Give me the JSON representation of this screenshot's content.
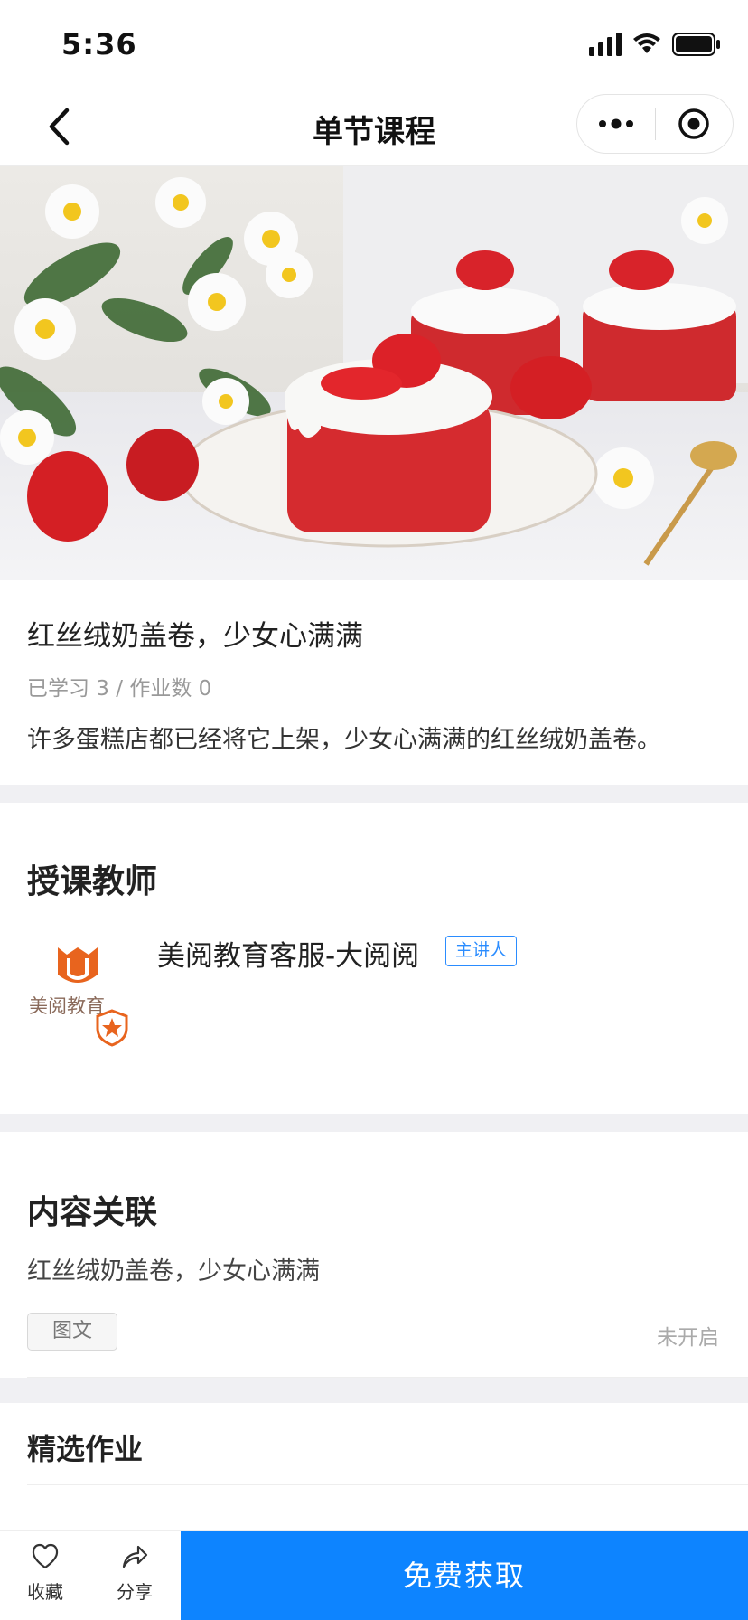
{
  "status_bar": {
    "time": "5:36"
  },
  "nav": {
    "title": "单节课程"
  },
  "course": {
    "title": "红丝绒奶盖卷，少女心满满",
    "stats": "已学习 3 / 作业数 0",
    "description": "许多蛋糕店都已经将它上架，少女心满满的红丝绒奶盖卷。"
  },
  "teacher_section": {
    "title": "授课教师",
    "teacher_name": "美阅教育客服-大阅阅",
    "badge": "主讲人",
    "avatar_logo_text": "美阅教育"
  },
  "related_section": {
    "title": "内容关联",
    "item_title": "红丝绒奶盖卷，少女心满满",
    "tag": "图文",
    "status": "未开启"
  },
  "homework_section": {
    "title": "精选作业"
  },
  "bottom_bar": {
    "favorite_label": "收藏",
    "share_label": "分享",
    "cta_label": "免费获取"
  },
  "colors": {
    "accent": "#0d84ff",
    "cake_red": "#d52b2f",
    "logo_orange": "#e8641e"
  }
}
